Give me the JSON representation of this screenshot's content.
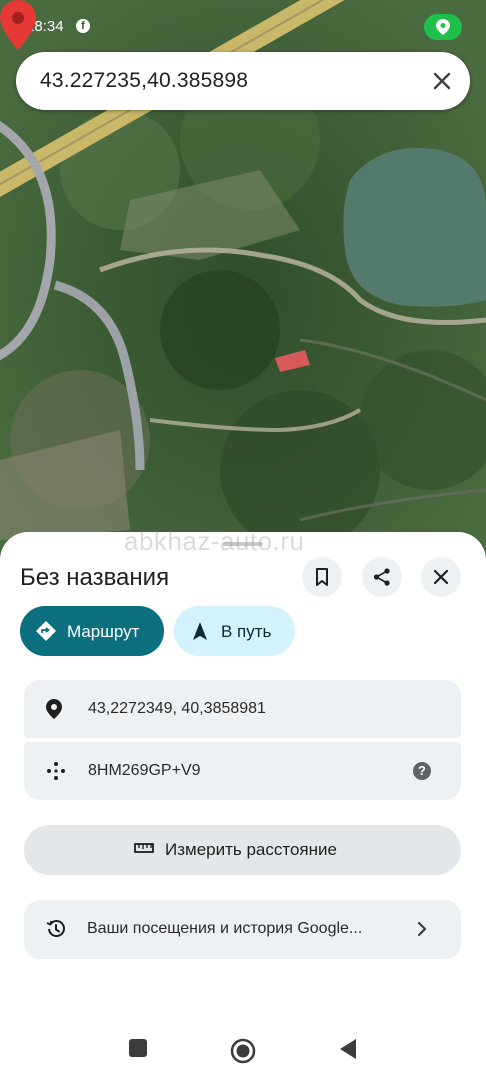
{
  "status_bar": {
    "time": "18:34",
    "fb_glyph": "f"
  },
  "search": {
    "query": "43.227235,40.385898"
  },
  "map": {
    "watermark": "abkhaz-auto.ru"
  },
  "place": {
    "title": "Без названия",
    "route_label": "Маршрут",
    "start_label": "В путь",
    "coordinates": "43,2272349, 40,3858981",
    "plus_code": "8HM269GP+V9",
    "help_glyph": "?",
    "measure_label": "Измерить расстояние",
    "history_label": "Ваши посещения и история Google..."
  },
  "colors": {
    "route_chip": "#0b6f7e",
    "start_chip": "#d4f2fb",
    "pin": "#e53935",
    "location_badge": "#1fbf4c"
  }
}
